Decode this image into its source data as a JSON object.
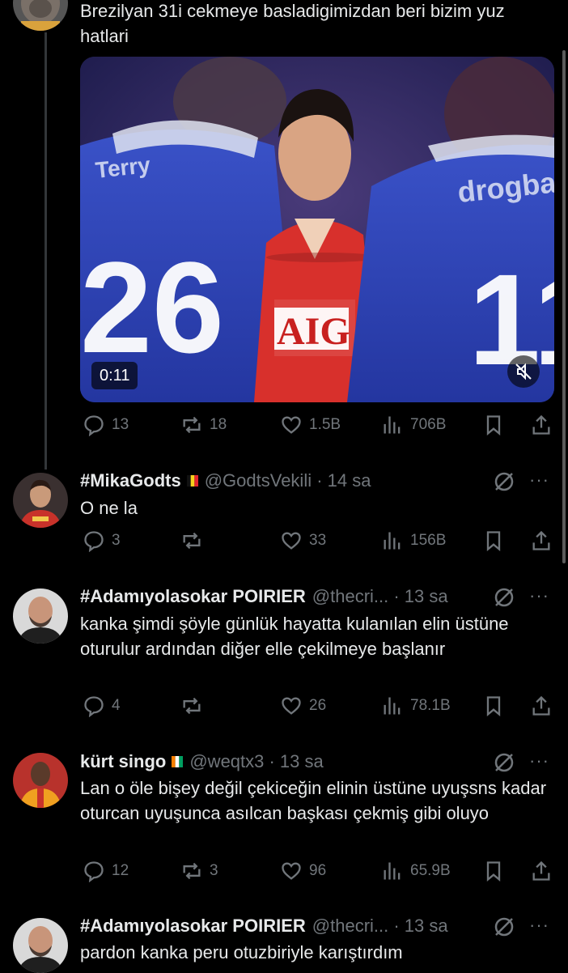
{
  "main_tweet": {
    "text": "Brezilyan 31i cekmeye basladigimizdan beri bizim yuz hatlari",
    "video": {
      "duration": "0:11",
      "left_shirt_name": "Terry",
      "left_shirt_number": "26",
      "right_shirt_name": "drogba",
      "right_shirt_number": "11",
      "center_shirt_text": "AIG"
    },
    "actions": {
      "replies": "13",
      "reposts": "18",
      "likes": "1.5B",
      "views": "706B"
    }
  },
  "replies": [
    {
      "name": "#MikaGodts",
      "handle": "@GodtsVekili · 14 sa",
      "text": "O ne la",
      "actions": {
        "replies": "3",
        "reposts": "",
        "likes": "33",
        "views": "156B"
      }
    },
    {
      "name": "#Adamıyolasokar POIRIER",
      "handle": "@thecri... · 13 sa",
      "text": "kanka şimdi şöyle günlük hayatta kulanılan elin üstüne oturulur ardından diğer elle çekilmeye başlanır",
      "actions": {
        "replies": "4",
        "reposts": "",
        "likes": "26",
        "views": "78.1B"
      }
    },
    {
      "name": "kürt singo",
      "handle": "@weqtx3 · 13 sa",
      "text": "Lan o öle bişey değil çekiceğin elinin üstüne uyuşsns kadar oturcan  uyuşunca asılcan başkası çekmiş gibi oluyo",
      "actions": {
        "replies": "12",
        "reposts": "3",
        "likes": "96",
        "views": "65.9B"
      }
    },
    {
      "name": "#Adamıyolasokar POIRIER",
      "handle": "@thecri... · 13 sa",
      "text": "pardon kanka peru otuzbiriyle karıştırdım"
    }
  ],
  "colors": {
    "background": "#000000",
    "text": "#e7e9ea",
    "muted": "#71767b",
    "divider": "#333639"
  },
  "icons": [
    "reply-icon",
    "repost-icon",
    "like-icon",
    "views-icon",
    "bookmark-icon",
    "share-icon",
    "grok-icon",
    "more-icon",
    "mute-icon"
  ]
}
